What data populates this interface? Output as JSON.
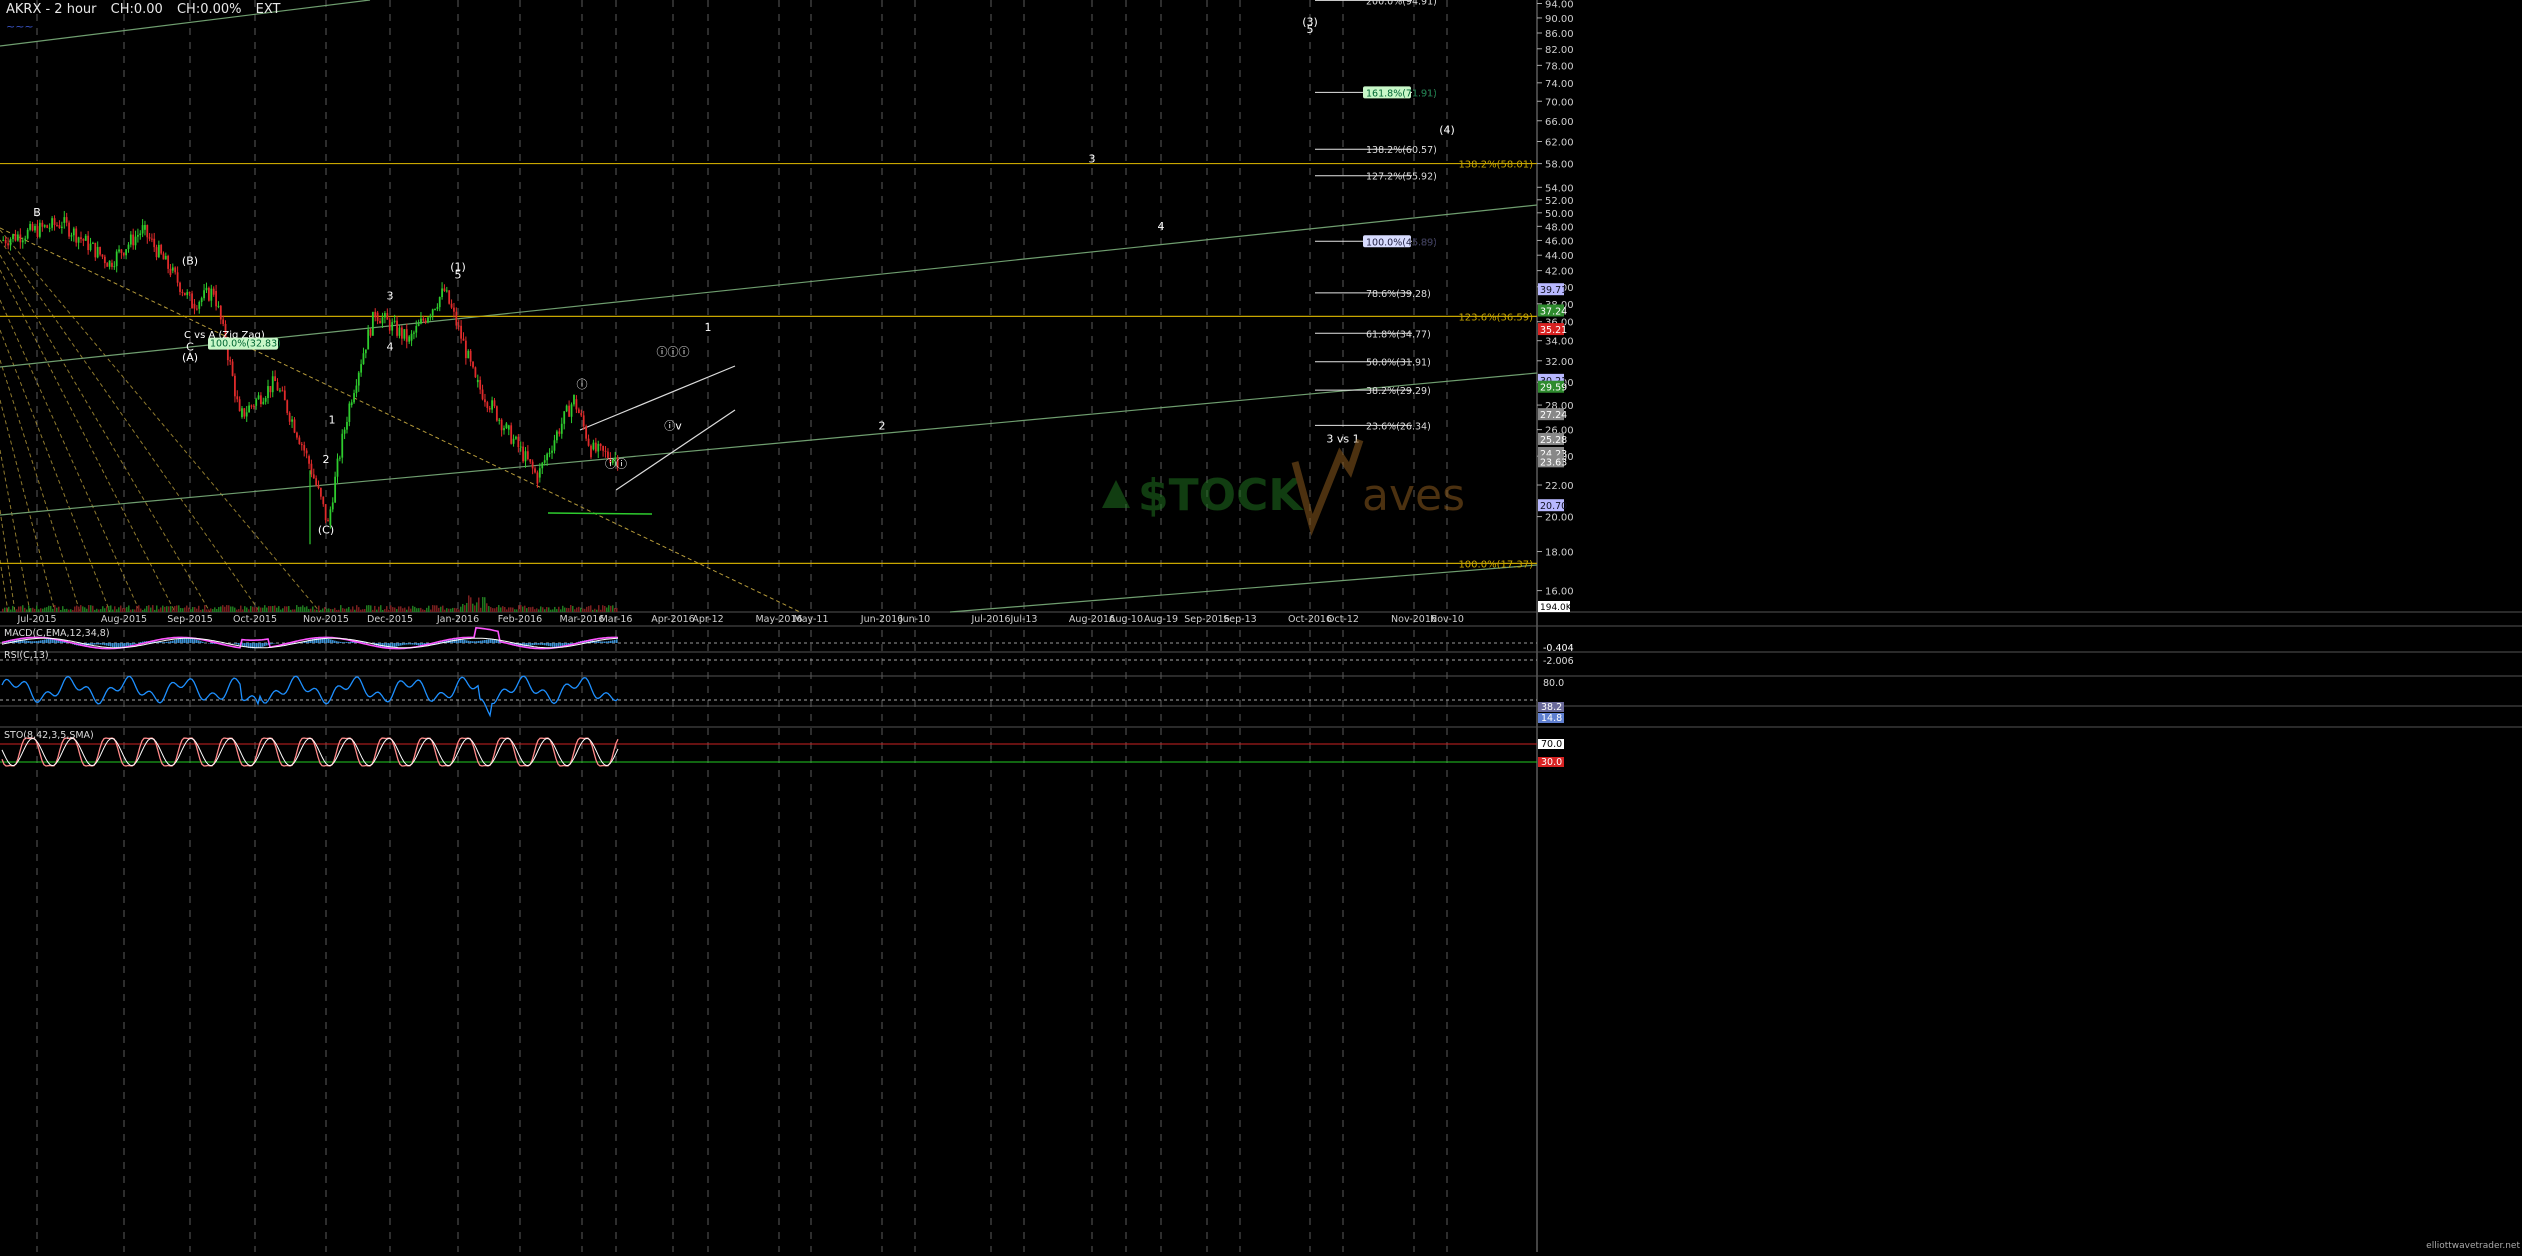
{
  "header": {
    "symbol_tf": "AKRX - 2 hour",
    "change": "CH:0.00",
    "change_pct": "CH:0.00%",
    "session": "EXT",
    "sub_label": "~~~"
  },
  "panels": {
    "macd_label": "MACD(C,EMA,12,34,8)",
    "rsi_label": "RSI(C,13)",
    "stoch_label": "STO(8,42,3,5,SMA)"
  },
  "watermark": {
    "text": "STOCKWaves",
    "left": "$TOCK",
    "right": "aves"
  },
  "footer": {
    "site": "elliottwavetrader.net"
  },
  "colors": {
    "background": "#000000",
    "up_candle": "#2ecc2e",
    "down_candle": "#e02b2b",
    "fib_line": "#c8a600",
    "trend_line": "#6f9e6f",
    "grid": "#5a5a5a",
    "macd": "#ff55ff",
    "rsi": "#1e90ff",
    "stoch": "#ff8a8a"
  },
  "chart_data": {
    "type": "candlestick",
    "title": "AKRX - 2 hour",
    "x_labels": [
      "Jul-2015",
      "Aug-2015",
      "Sep-2015",
      "Oct-2015",
      "Nov-2015",
      "Dec-2015",
      "Jan-2016",
      "Feb-2016",
      "Mar-2016",
      "Mar-16",
      "Apr-2016",
      "Apr-12",
      "May-2016",
      "May-11",
      "Jun-2016",
      "Jun-10",
      "Jul-2016",
      "Jul-13",
      "Aug-2016",
      "Aug-10",
      "Aug-19",
      "Sep-2016",
      "Sep-13",
      "Oct-2016",
      "Oct-12",
      "Nov-2016",
      "Nov-10"
    ],
    "y_ticks": [
      "94.00",
      "90.00",
      "86.00",
      "82.00",
      "78.00",
      "74.00",
      "70.00",
      "66.00",
      "62.00",
      "58.00",
      "54.00",
      "52.00",
      "50.00",
      "48.00",
      "46.00",
      "44.00",
      "42.00",
      "40.00",
      "38.00",
      "36.00",
      "34.00",
      "32.00",
      "30.00",
      "28.00",
      "26.00",
      "24.00",
      "22.00",
      "20.00",
      "18.00",
      "16.00"
    ],
    "ylim": [
      15,
      95
    ],
    "log_scale": true,
    "grid": true,
    "price_path": [
      {
        "x": "Jul-2015",
        "y": 46
      },
      {
        "x": "Jul-2015",
        "y": 48.5
      },
      {
        "x": "Aug-2015",
        "y": 43
      },
      {
        "x": "Aug-2015",
        "y": 47.5
      },
      {
        "x": "Sep-2015",
        "y": 42
      },
      {
        "x": "Sep-2015",
        "y": 38
      },
      {
        "x": "Sep-2015",
        "y": 39.5
      },
      {
        "x": "Oct-2015",
        "y": 27
      },
      {
        "x": "Oct-2015",
        "y": 30
      },
      {
        "x": "Nov-2015",
        "y": 24
      },
      {
        "x": "Nov-2015",
        "y": 19.5
      },
      {
        "x": "Nov-2015",
        "y": 28
      },
      {
        "x": "Dec-2015",
        "y": 37
      },
      {
        "x": "Dec-2015",
        "y": 34
      },
      {
        "x": "Jan-2016",
        "y": 39.5
      },
      {
        "x": "Jan-2016",
        "y": 30
      },
      {
        "x": "Feb-2016",
        "y": 26
      },
      {
        "x": "Feb-2016",
        "y": 22.5
      },
      {
        "x": "Mar-2016",
        "y": 28.5
      },
      {
        "x": "Mar-2016",
        "y": 24.5
      },
      {
        "x": "Mar-16",
        "y": 23.8
      }
    ],
    "fib_levels": [
      {
        "label": "200.0%(94.91)",
        "value": 94.91
      },
      {
        "label": "161.8%(71.91)",
        "value": 71.91
      },
      {
        "label": "138.2%(60.57)",
        "value": 60.57
      },
      {
        "label": "127.2%(55.92)",
        "value": 55.92
      },
      {
        "label": "100.0%(45.89)",
        "value": 45.89
      },
      {
        "label": "78.6%(39.28)",
        "value": 39.28
      },
      {
        "label": "61.8%(34.77)",
        "value": 34.77
      },
      {
        "label": "50.0%(31.91)",
        "value": 31.91
      },
      {
        "label": "38.2%(29.29)",
        "value": 29.29
      },
      {
        "label": "23.6%(26.34)",
        "value": 26.34
      }
    ],
    "horizontal_levels": [
      {
        "label": "138.2%(58.01)",
        "value": 58.01
      },
      {
        "label": "123.6%(36.59)",
        "value": 36.59
      },
      {
        "label": "100.0%(17.37)",
        "value": 17.37
      }
    ],
    "price_boxes": [
      {
        "label": "39.71",
        "value": 39.71
      },
      {
        "label": "37.24",
        "value": 37.24
      },
      {
        "label": "35.21",
        "value": 35.21
      },
      {
        "label": "30.21",
        "value": 30.21
      },
      {
        "label": "29.59",
        "value": 29.59
      },
      {
        "label": "27.24",
        "value": 27.24
      },
      {
        "label": "25.28",
        "value": 25.28
      },
      {
        "label": "24.23",
        "value": 24.23
      },
      {
        "label": "23.63",
        "value": 23.63
      },
      {
        "label": "20.70",
        "value": 20.7
      }
    ],
    "volume_label": "194.0K",
    "wave_labels": [
      {
        "text": "B",
        "x": "Jul-2015",
        "y": 49.5
      },
      {
        "text": "(B)",
        "x": "Sep-2015",
        "y": 42.8
      },
      {
        "text": "C",
        "x": "Sep-2015",
        "y": 33
      },
      {
        "text": "(A)",
        "x": "Sep-2015",
        "y": 32
      },
      {
        "text": "C vs A (Zig Zag)",
        "x": "Sep-2015",
        "y": 34.3
      },
      {
        "text": "100.0%(32.83)",
        "x": "Sep-2015",
        "y": 33.4
      },
      {
        "text": "(1)",
        "x": "Jan-2016",
        "y": 42
      },
      {
        "text": "5",
        "x": "Jan-2016",
        "y": 41
      },
      {
        "text": "3",
        "x": "Dec-2015",
        "y": 38.5
      },
      {
        "text": "4",
        "x": "Dec-2015",
        "y": 33
      },
      {
        "text": "1",
        "x": "Nov-2015",
        "y": 26.5
      },
      {
        "text": "2",
        "x": "Nov-2015",
        "y": 23.5
      },
      {
        "text": "(C)",
        "x": "Nov-2015",
        "y": 19
      },
      {
        "text": "ⓘ",
        "x": "Mar-2016",
        "y": 29.5
      },
      {
        "text": "ⓘⓘ",
        "x": "Mar-16",
        "y": 23.2
      },
      {
        "text": "ⓘⓘⓘ",
        "x": "Apr-2016",
        "y": 32.5
      },
      {
        "text": "ⓘv",
        "x": "Apr-2016",
        "y": 26
      },
      {
        "text": "1",
        "x": "Apr-12",
        "y": 35
      },
      {
        "text": "2",
        "x": "Jun-2016",
        "y": 26
      },
      {
        "text": "3",
        "x": "Aug-2016",
        "y": 58.2
      },
      {
        "text": "4",
        "x": "Aug-19",
        "y": 47.5
      },
      {
        "text": "(3)",
        "x": "Oct-2016",
        "y": 88
      },
      {
        "text": "5",
        "x": "Oct-2016",
        "y": 86
      },
      {
        "text": "(4)",
        "x": "Nov-10",
        "y": 63.5
      },
      {
        "text": "3 vs 1",
        "x": "Oct-12",
        "y": 25
      }
    ],
    "indicators": {
      "macd": {
        "right_labels": [
          "-0.404",
          "-2.006"
        ]
      },
      "rsi": {
        "right_labels": [
          "80.0",
          "38.2",
          "14.8"
        ]
      },
      "stoch": {
        "right_labels": [
          "70.0",
          "30.0"
        ]
      }
    }
  }
}
